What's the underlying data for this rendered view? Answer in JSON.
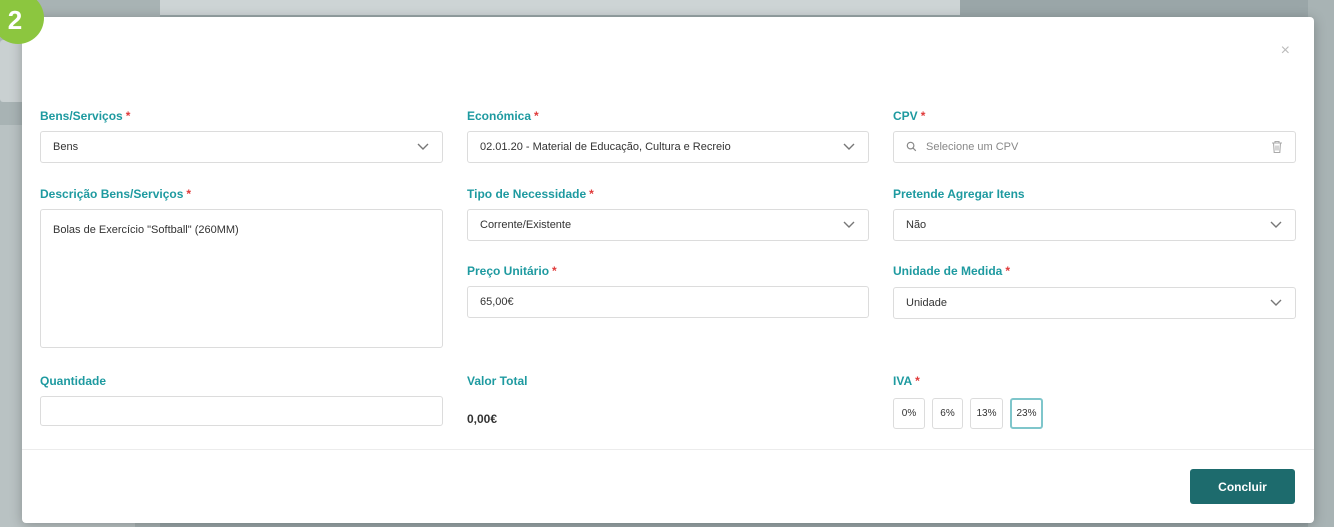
{
  "step_badge": "2",
  "modal": {
    "close_glyph": "×",
    "bens_servicos": {
      "label": "Bens/Serviços",
      "value": "Bens"
    },
    "economica": {
      "label": "Económica",
      "value": "02.01.20 - Material de Educação, Cultura e Recreio"
    },
    "cpv": {
      "label": "CPV",
      "placeholder": "Selecione um CPV"
    },
    "descricao": {
      "label": "Descrição Bens/Serviços",
      "value": "Bolas de Exercício \"Softball\" (260MM)"
    },
    "tipo_necessidade": {
      "label": "Tipo de Necessidade",
      "value": "Corrente/Existente"
    },
    "agregar_itens": {
      "label": "Pretende Agregar Itens",
      "value": "Não"
    },
    "preco_unitario": {
      "label": "Preço Unitário",
      "value": "65,00€"
    },
    "unidade_medida": {
      "label": "Unidade de Medida",
      "value": "Unidade"
    },
    "quantidade": {
      "label": "Quantidade",
      "value": ""
    },
    "valor_total": {
      "label": "Valor Total",
      "value": "0,00€"
    },
    "iva": {
      "label": "IVA",
      "options": [
        "0%",
        "6%",
        "13%",
        "23%"
      ],
      "selected": "23%"
    },
    "required_mark": "*",
    "submit_label": "Concluir"
  },
  "colors": {
    "label_teal": "#1e9aa0",
    "required_red": "#e03a3a",
    "button_dark_teal": "#1d6b6d",
    "badge_green": "#8cc63f"
  }
}
